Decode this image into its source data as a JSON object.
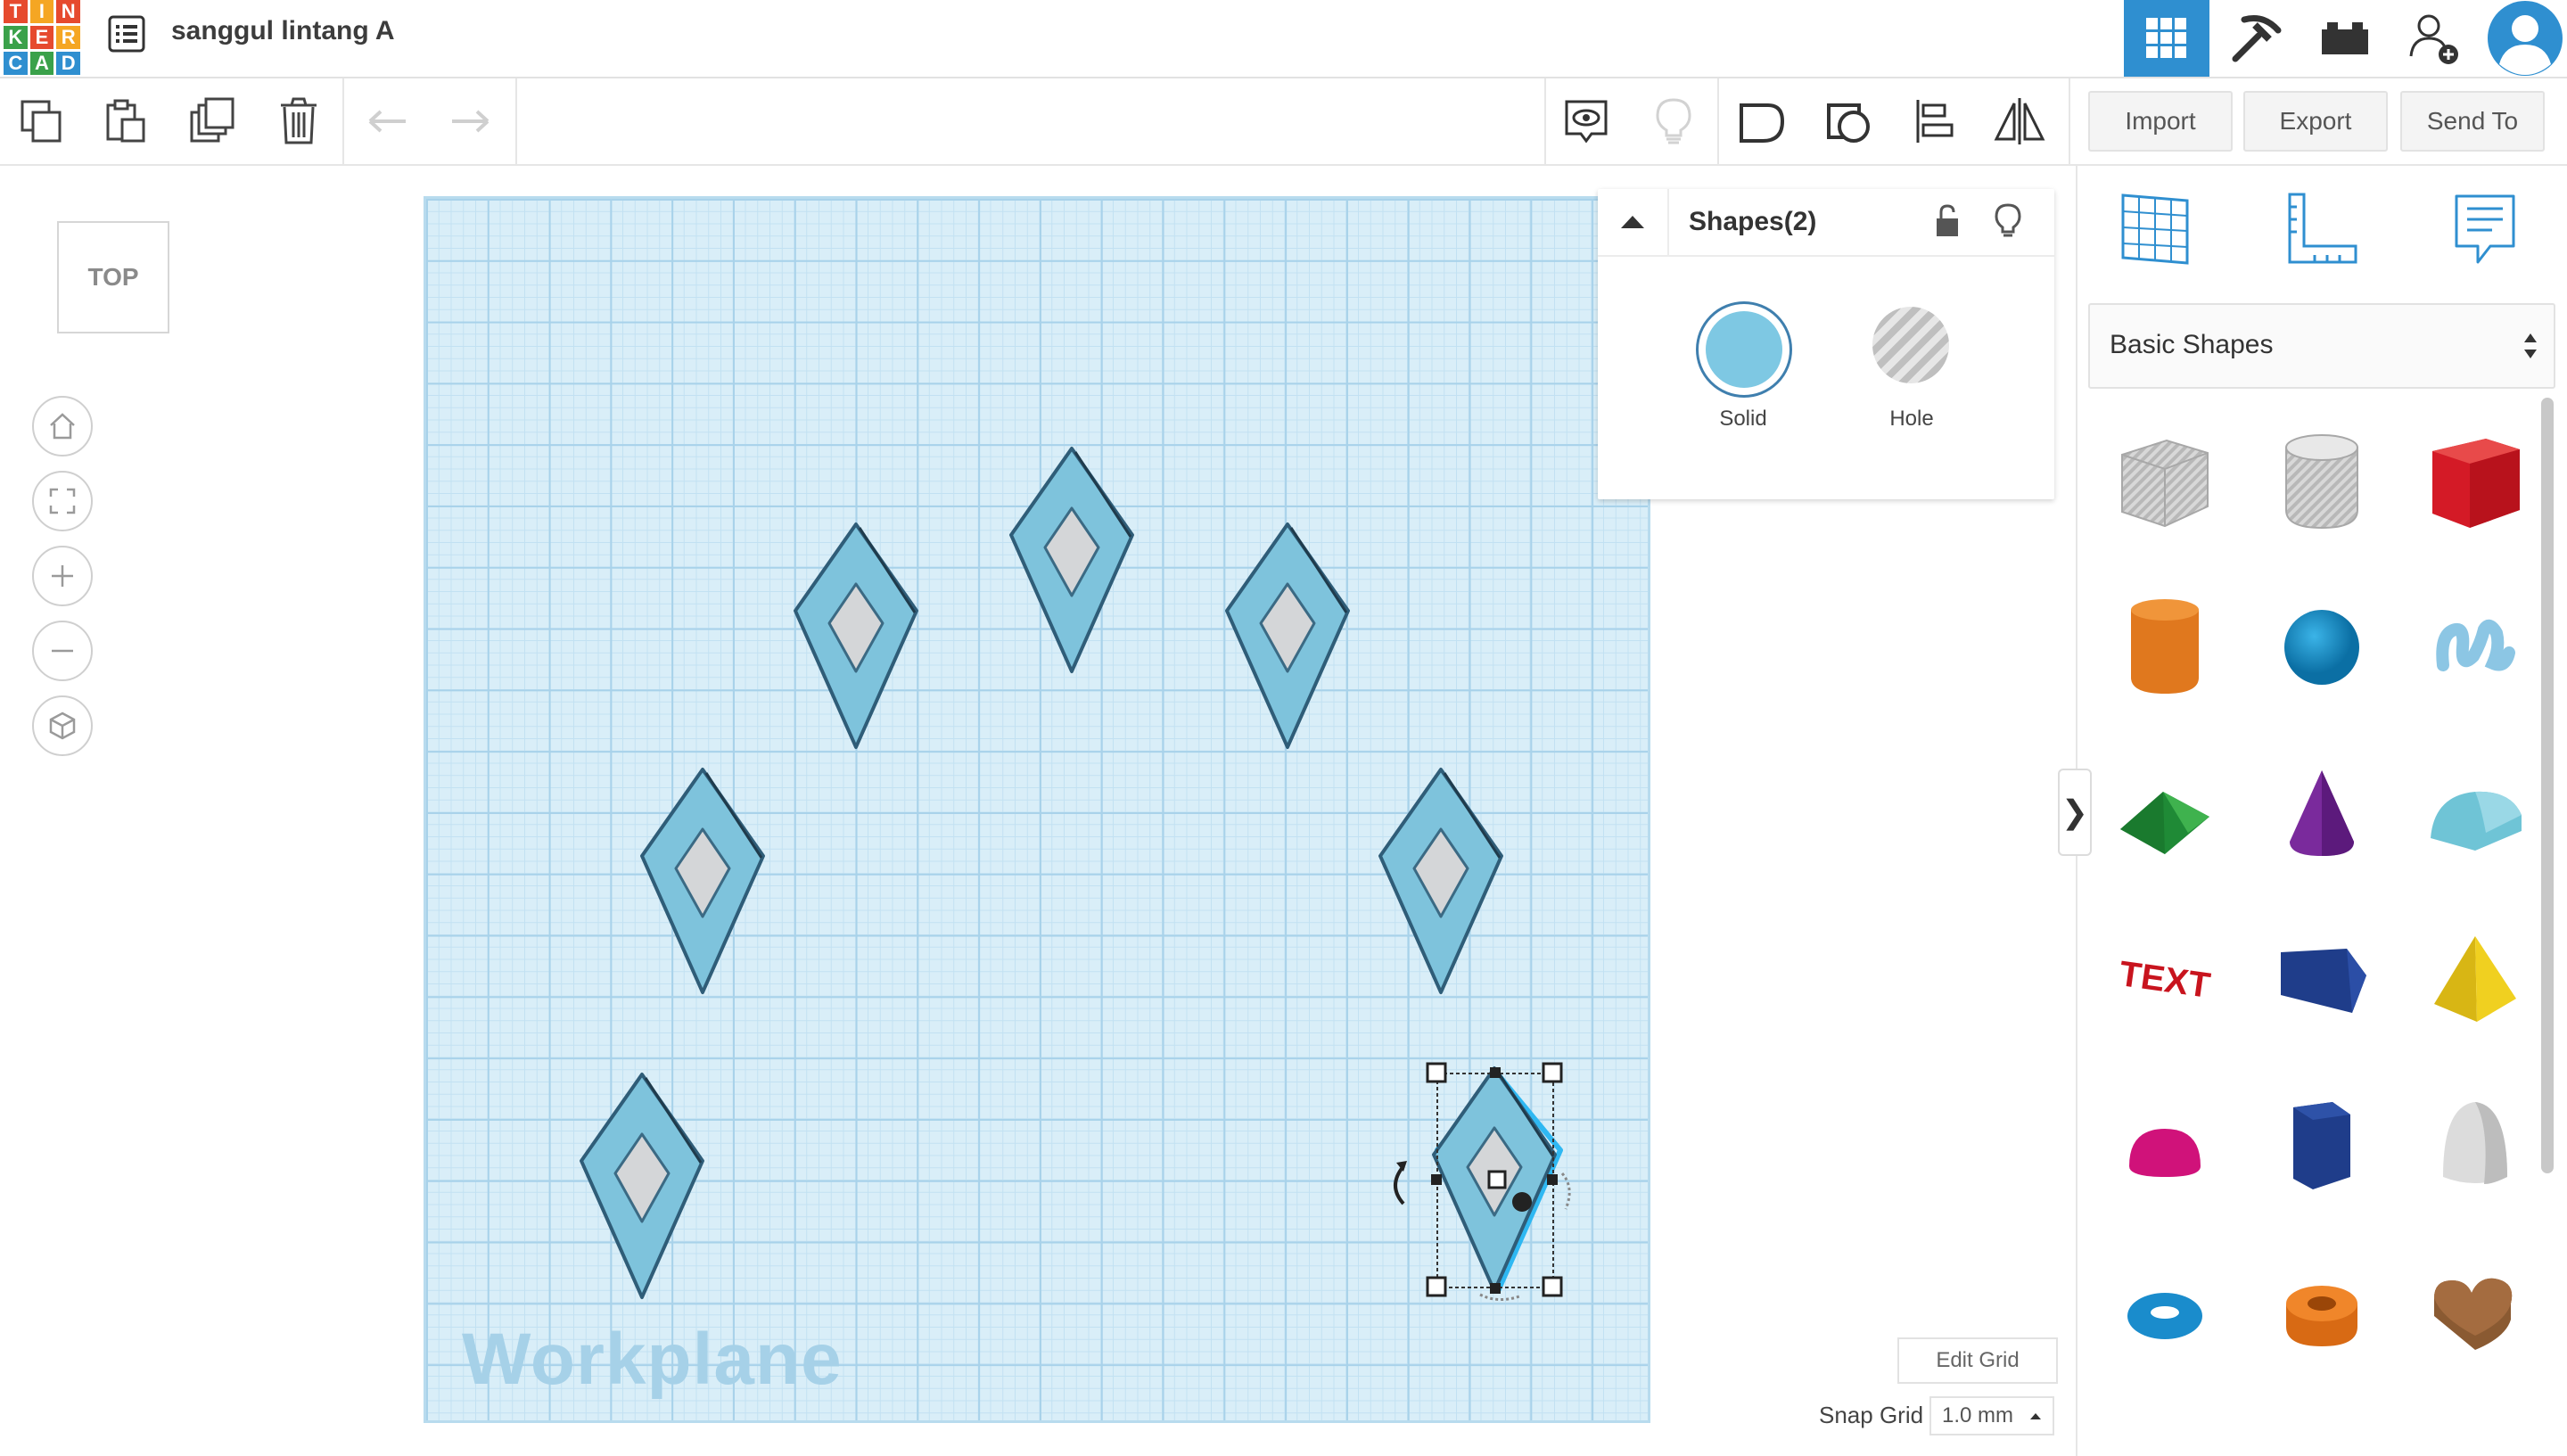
{
  "app": {
    "logo_letters": [
      "T",
      "I",
      "N",
      "K",
      "E",
      "R",
      "C",
      "A",
      "D"
    ],
    "logo_colors": [
      "#e64a2e",
      "#f5a623",
      "#e64a2e",
      "#3aa14a",
      "#e64a2e",
      "#f5a623",
      "#2f8fd0",
      "#3aa14a",
      "#2f8fd0"
    ],
    "project_title": "sanggul lintang A"
  },
  "top_nav": {
    "items": [
      {
        "name": "3d-design-grid",
        "icon": "grid-icon",
        "active": true
      },
      {
        "name": "codeblocks",
        "icon": "pickaxe-icon",
        "active": false
      },
      {
        "name": "bricks",
        "icon": "brick-icon",
        "active": false
      },
      {
        "name": "invite-user",
        "icon": "add-user-icon",
        "active": false
      },
      {
        "name": "profile",
        "icon": "avatar-icon",
        "active": false
      }
    ],
    "accent": "#2f8fd0"
  },
  "toolbar": {
    "left_tools": [
      "copy-icon",
      "paste-icon",
      "duplicate-icon",
      "trash-icon",
      "undo-icon",
      "redo-icon"
    ],
    "right_tools": [
      "show-all-icon",
      "light-bulb-icon",
      "group-icon",
      "ungroup-icon",
      "align-icon",
      "mirror-icon"
    ],
    "import_label": "Import",
    "export_label": "Export",
    "send_to_label": "Send To"
  },
  "view": {
    "cube_label": "TOP",
    "nav": [
      "home-icon",
      "fit-icon",
      "zoom-in-icon",
      "zoom-out-icon",
      "perspective-icon"
    ]
  },
  "workplane": {
    "label": "Workplane",
    "shape_color": "#7ec3dc",
    "inner_color": "#d4d6d8",
    "outline": "#2f5d78",
    "edit_grid_label": "Edit Grid",
    "snap_grid_label": "Snap Grid",
    "snap_grid_value": "1.0 mm"
  },
  "inspector": {
    "title": "Shapes(2)",
    "solid_label": "Solid",
    "hole_label": "Hole",
    "solid_color": "#7ec8e3"
  },
  "library": {
    "tabs": [
      "workplane-icon",
      "ruler-icon",
      "notes-icon"
    ],
    "category": "Basic Shapes",
    "shapes": [
      "box-hole",
      "cylinder-hole",
      "box",
      "cylinder",
      "sphere",
      "scribble",
      "roof",
      "cone",
      "round-roof",
      "text",
      "wedge",
      "pyramid",
      "half-sphere",
      "polygon",
      "paraboloid",
      "torus",
      "tube",
      "heart"
    ]
  }
}
